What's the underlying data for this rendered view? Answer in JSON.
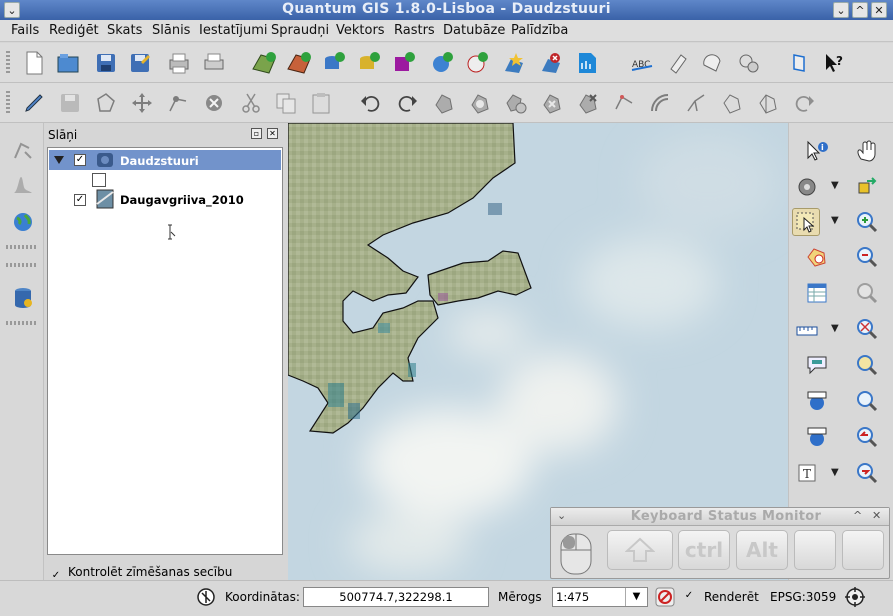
{
  "window": {
    "title": "Quantum GIS 1.8.0-Lisboa - Daudzstuuri"
  },
  "menubar": {
    "items": [
      "Fails",
      "Rediģēt",
      "Skats",
      "Slānis",
      "Iestatījumi",
      "Spraudņi",
      "Vektors",
      "Rastrs",
      "Datubāze",
      "Palīdzība"
    ]
  },
  "layers_panel": {
    "title": "Slāņi",
    "group_name": "Daudzstuuri",
    "layer_name": "Daugavgriiva_2010",
    "render_order_label": "Kontrolēt zīmēšanas secību"
  },
  "keyboard_monitor": {
    "title": "Keyboard Status Monitor",
    "keys": [
      "ctrl",
      "Alt"
    ]
  },
  "statusbar": {
    "coords_label": "Koordinātas:",
    "coords_value": "500774.7,322298.1",
    "scale_label": "Mērogs",
    "scale_value": "1:475",
    "render_label": "Renderēt",
    "crs": "EPSG:3059"
  },
  "colors": {
    "titlebar": "#4a72b8",
    "selection": "#7293cb",
    "land": "#a9b48c",
    "water": "#c6d8e2"
  }
}
